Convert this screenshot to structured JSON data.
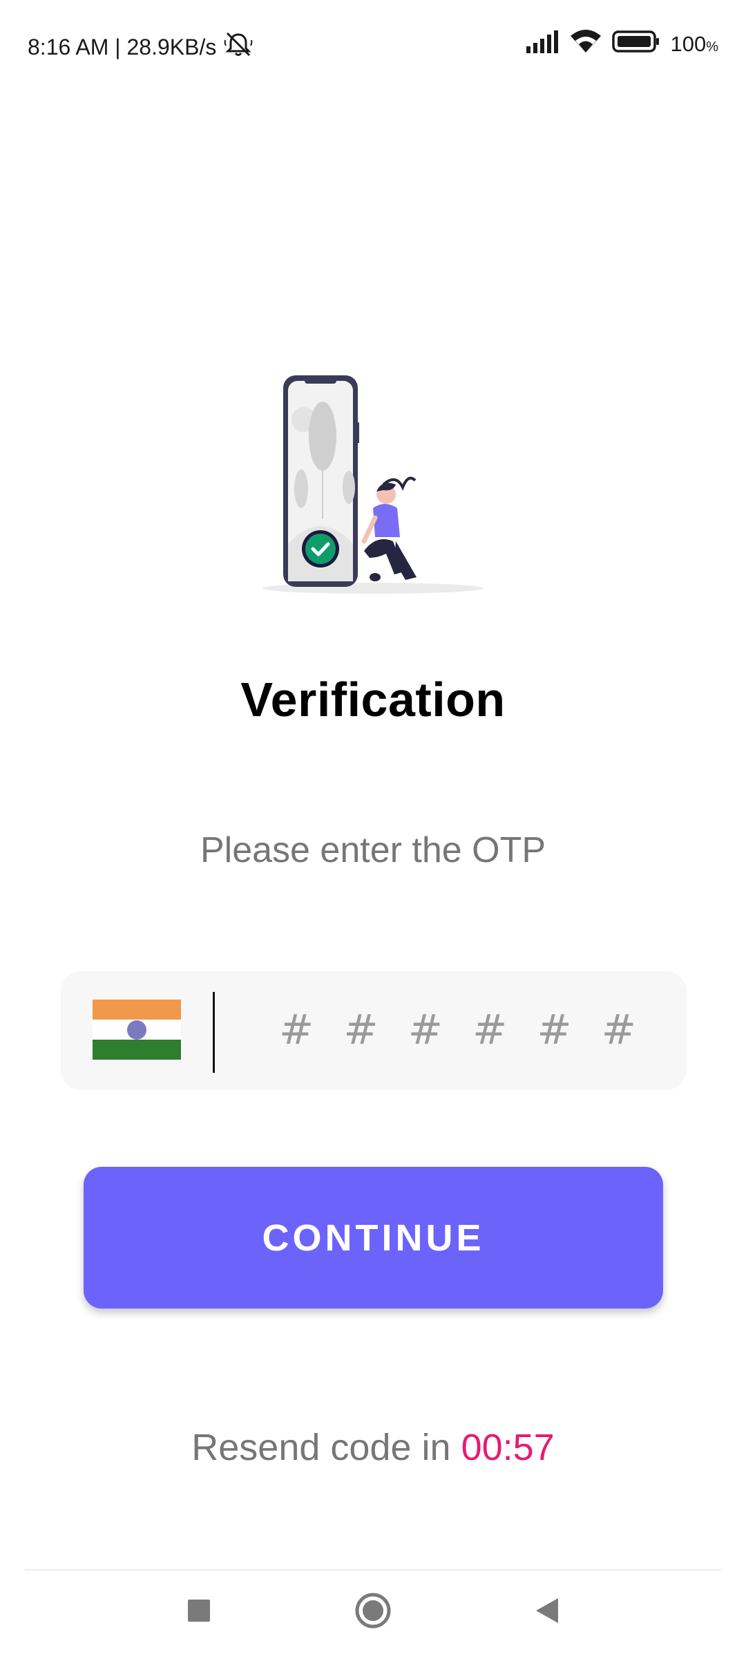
{
  "status_bar": {
    "time_speed": "8:16 AM | 28.9KB/s",
    "battery": "100",
    "battery_unit": "%"
  },
  "verification": {
    "title": "Verification",
    "subtitle": "Please enter the OTP"
  },
  "otp": {
    "placeholder": "# # # # # #",
    "country_flag": "india-flag-icon"
  },
  "continue_button": {
    "label": "CONTINUE",
    "color": "#6c63fb"
  },
  "resend": {
    "prefix": "Resend code in",
    "timer": "00:57",
    "timer_color": "#e61b72"
  },
  "nav": {
    "recent_icon": "square-icon",
    "home_icon": "circle-icon",
    "back_icon": "triangle-back-icon"
  }
}
